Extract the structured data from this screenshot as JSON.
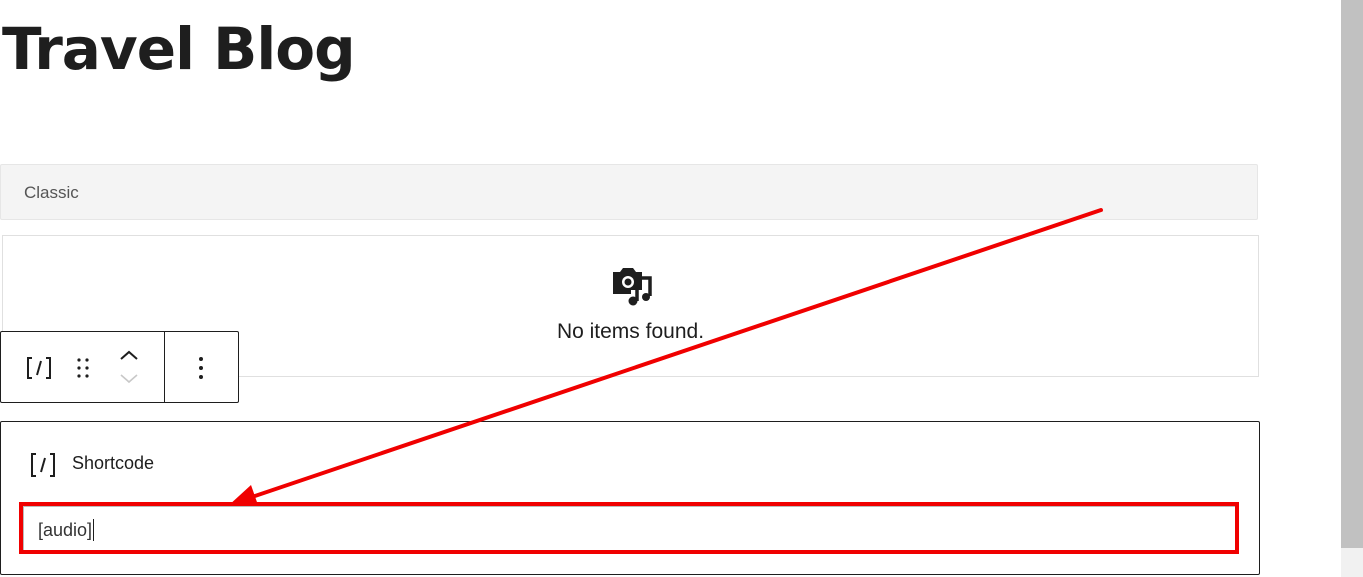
{
  "page": {
    "title": "Travel Blog"
  },
  "classic_block": {
    "label": "Classic"
  },
  "media_block": {
    "icon": "camera-music-icon",
    "empty_text": "No items found."
  },
  "block_toolbar": {
    "block_type_icon": "shortcode-icon",
    "block_type_glyph": "[/]",
    "drag_icon": "drag-handle-icon",
    "move_up_icon": "chevron-up-icon",
    "move_down_icon": "chevron-down-icon",
    "more_icon": "more-vertical-icon"
  },
  "shortcode_block": {
    "icon": "shortcode-icon",
    "icon_glyph": "[/]",
    "label": "Shortcode",
    "input_value": "[audio]"
  },
  "annotations": {
    "highlight_color": "#f00000",
    "arrow_color": "#f00000"
  }
}
